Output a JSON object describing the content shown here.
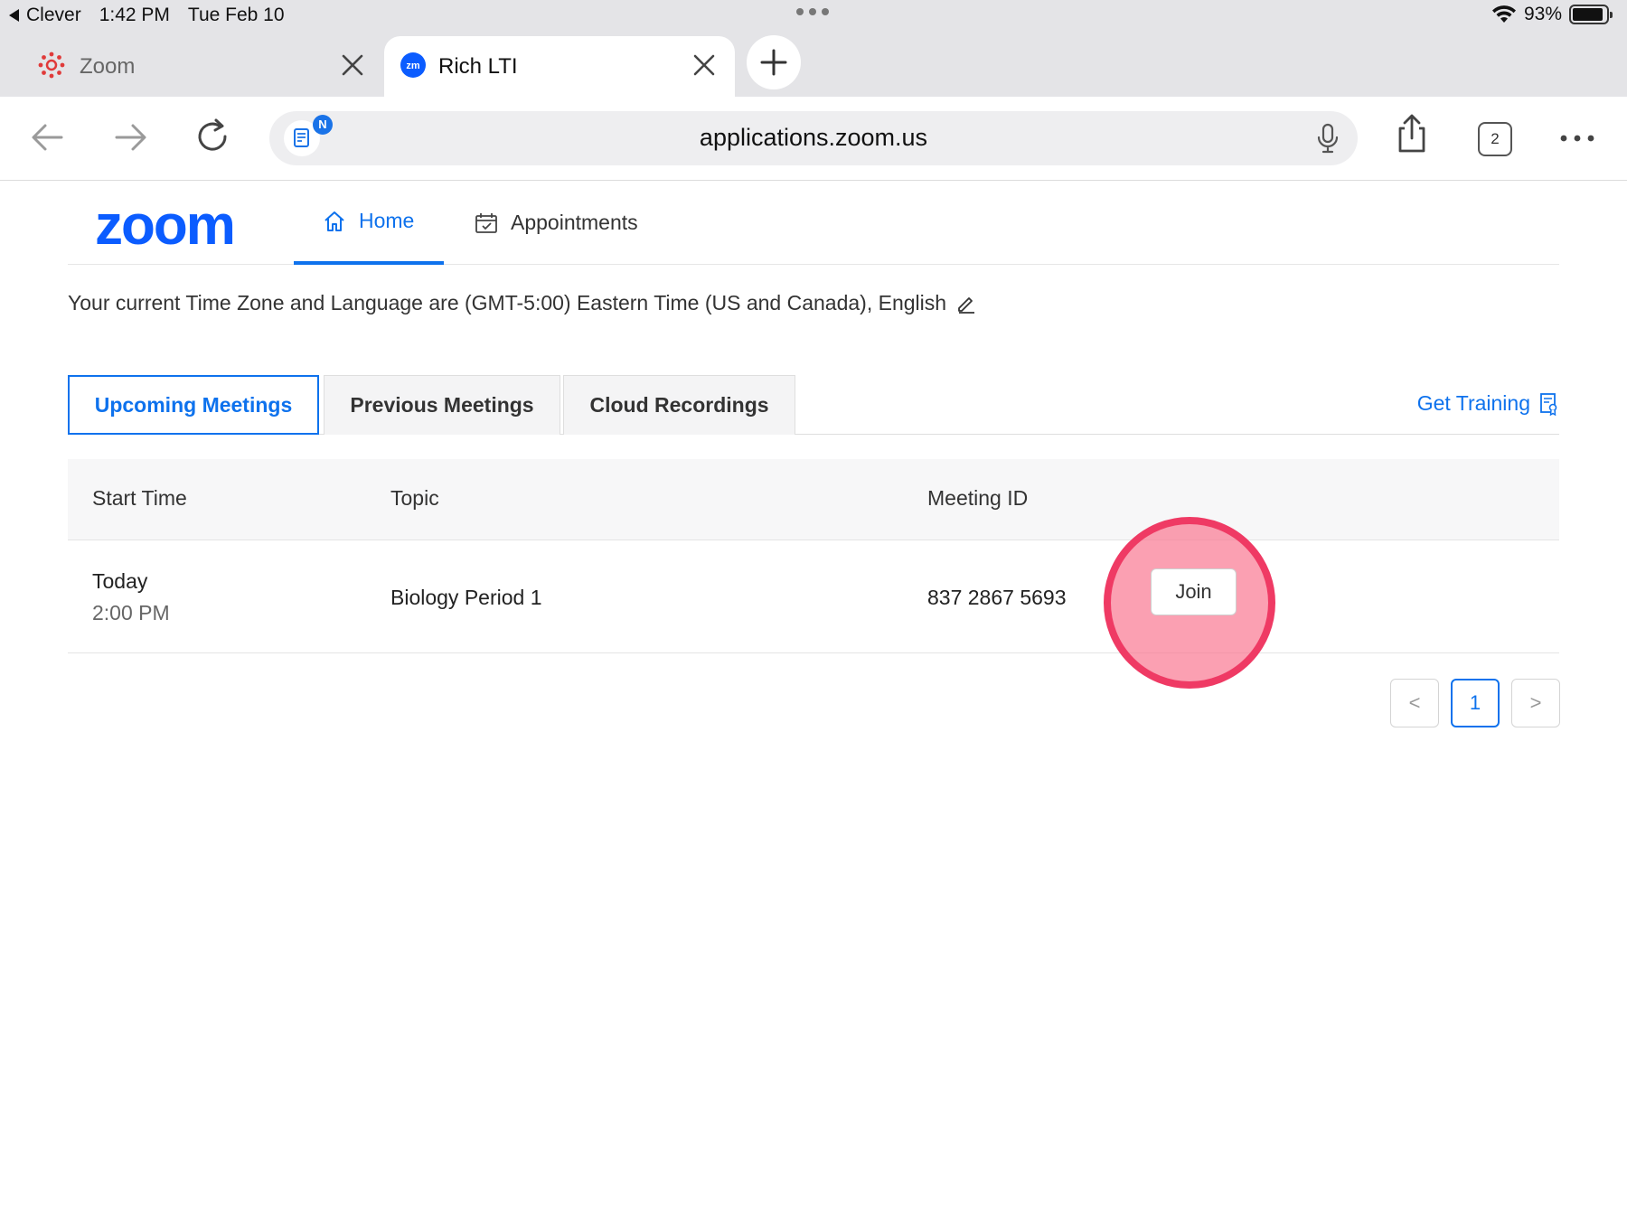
{
  "status_bar": {
    "back_app": "Clever",
    "time": "1:42 PM",
    "date": "Tue Feb 10",
    "battery": "93%",
    "battery_level": 0.93
  },
  "browser": {
    "tabs": [
      {
        "title": "Zoom",
        "icon": "canvas-logo-icon",
        "active": false
      },
      {
        "title": "Rich LTI",
        "icon": "zoom-zm-icon",
        "active": true
      }
    ],
    "url": "applications.zoom.us",
    "tab_count": "2",
    "reader_badge": "N"
  },
  "zoom": {
    "logo_text": "zoom",
    "nav": {
      "home": "Home",
      "appointments": "Appointments"
    },
    "timezone_text": "Your current Time Zone and Language are (GMT-5:00) Eastern Time (US and Canada), English",
    "tabs": {
      "upcoming": "Upcoming Meetings",
      "previous": "Previous Meetings",
      "cloud": "Cloud Recordings"
    },
    "get_training": "Get Training",
    "table": {
      "columns": [
        "Start Time",
        "Topic",
        "Meeting ID"
      ],
      "rows": [
        {
          "day": "Today",
          "time": "2:00 PM",
          "topic": "Biology Period 1",
          "meeting_id": "837 2867 5693",
          "action": "Join"
        }
      ]
    },
    "pagination": {
      "prev": "<",
      "current": "1",
      "next": ">"
    }
  },
  "colors": {
    "accent": "#0e72ed",
    "tap_highlight": "#ef3a64"
  }
}
